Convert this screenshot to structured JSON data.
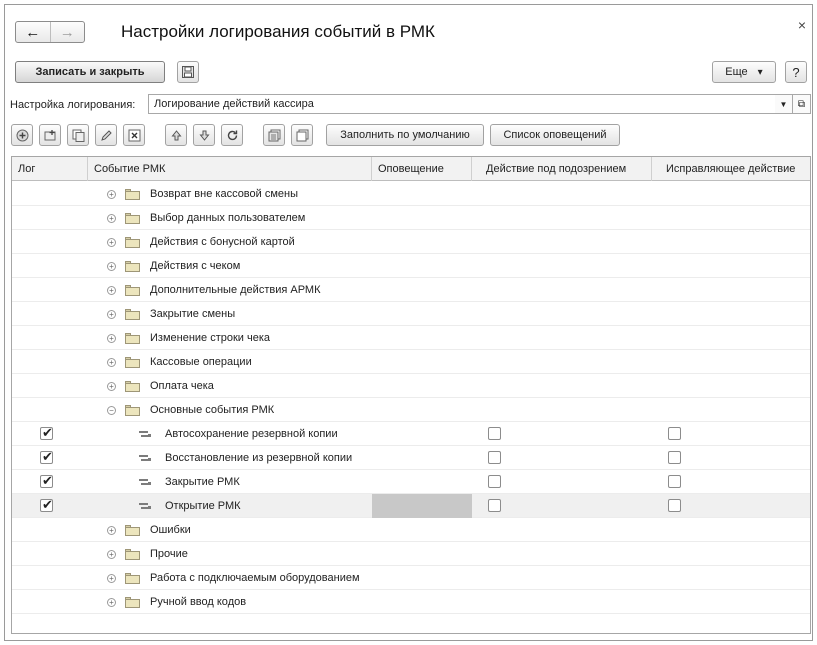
{
  "window": {
    "title": "Настройки логирования событий в РМК",
    "back_label": "←",
    "forward_label": "→",
    "close_label": "×"
  },
  "toolbar": {
    "save_close_label": "Записать и закрыть",
    "more_label": "Еще",
    "more_arrow": "▾",
    "help_label": "?"
  },
  "setting": {
    "label": "Настройка логирования:",
    "value": "Логирование действий кассира"
  },
  "table_toolbar": {
    "icons": [
      "add-icon",
      "add-group-icon",
      "copy-icon",
      "edit-icon",
      "delete-icon",
      "move-up-icon",
      "move-down-icon",
      "refresh-icon",
      "expand-all-icon",
      "collapse-all-icon"
    ],
    "fill_default_label": "Заполнить по умолчанию",
    "notifications_list_label": "Список оповещений"
  },
  "table": {
    "columns": [
      "Лог",
      "Событие РМК",
      "Оповещение",
      "Действие под подозрением",
      "Исправляющее действие"
    ],
    "rows": [
      {
        "type": "group",
        "expanded": false,
        "name": "Возврат вне кассовой смены"
      },
      {
        "type": "group",
        "expanded": false,
        "name": "Выбор данных пользователем"
      },
      {
        "type": "group",
        "expanded": false,
        "name": "Действия с бонусной картой"
      },
      {
        "type": "group",
        "expanded": false,
        "name": "Действия с чеком"
      },
      {
        "type": "group",
        "expanded": false,
        "name": "Дополнительные действия АРМК"
      },
      {
        "type": "group",
        "expanded": false,
        "name": "Закрытие смены"
      },
      {
        "type": "group",
        "expanded": false,
        "name": "Изменение строки чека"
      },
      {
        "type": "group",
        "expanded": false,
        "name": "Кассовые операции"
      },
      {
        "type": "group",
        "expanded": false,
        "name": "Оплата чека"
      },
      {
        "type": "group",
        "expanded": true,
        "name": "Основные события РМК"
      },
      {
        "type": "item",
        "name": "Автосохранение резервной копии",
        "log": true,
        "suspicious": false,
        "corrective": false
      },
      {
        "type": "item",
        "name": "Восстановление из резервной копии",
        "log": true,
        "suspicious": false,
        "corrective": false
      },
      {
        "type": "item",
        "name": "Закрытие РМК",
        "log": true,
        "suspicious": false,
        "corrective": false
      },
      {
        "type": "item",
        "name": "Открытие РМК",
        "log": true,
        "suspicious": false,
        "corrective": false,
        "selected": true
      },
      {
        "type": "group",
        "expanded": false,
        "name": "Ошибки"
      },
      {
        "type": "group",
        "expanded": false,
        "name": "Прочие"
      },
      {
        "type": "group",
        "expanded": false,
        "name": "Работа с подключаемым оборудованием"
      },
      {
        "type": "group",
        "expanded": false,
        "name": "Ручной ввод кодов"
      }
    ]
  }
}
